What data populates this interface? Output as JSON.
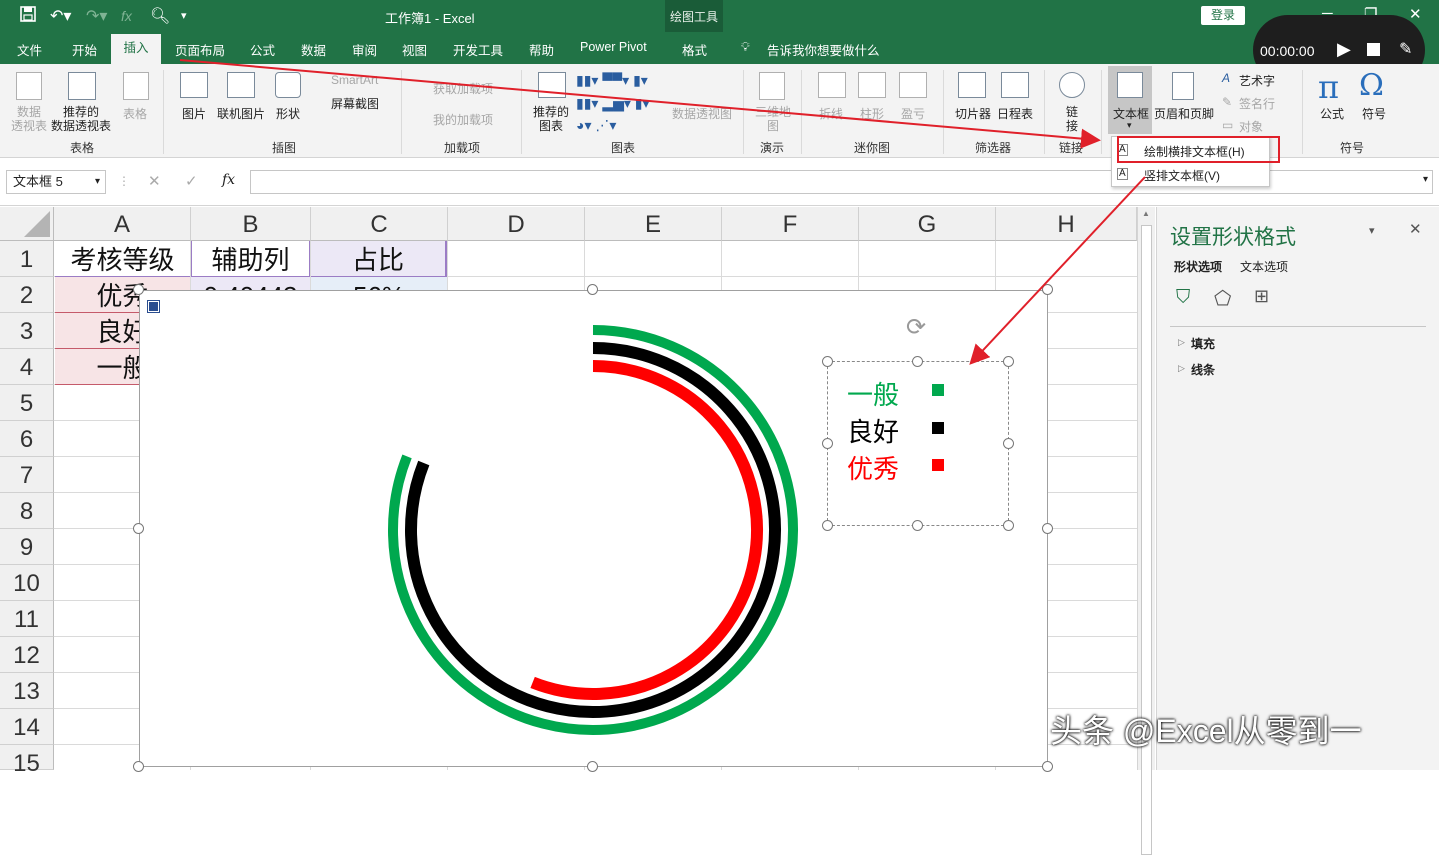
{
  "titlebar": {
    "doc_title": "工作簿1  -  Excel",
    "contextual_group": "绘图工具",
    "login": "登录"
  },
  "tabs": [
    "文件",
    "开始",
    "插入",
    "页面布局",
    "公式",
    "数据",
    "审阅",
    "视图",
    "开发工具",
    "帮助",
    "Power Pivot",
    "格式"
  ],
  "tell_me": "告诉我你想要做什么",
  "recorder": {
    "time": "00:00:00"
  },
  "ribbon": {
    "groups": {
      "tables": "表格",
      "illustrations": "插图",
      "addins": "加载项",
      "charts": "图表",
      "tours": "演示",
      "sparklines": "迷你图",
      "filters": "筛选器",
      "links": "链接",
      "text": "文本",
      "symbols": "符号"
    },
    "buttons": {
      "pivot_table": "数据\n透视表",
      "recommended_pivot": "推荐的\n数据透视表",
      "table": "表格",
      "pictures": "图片",
      "online_pictures": "联机图片",
      "shapes": "形状",
      "smartart": "SmartArt",
      "screenshot": "屏幕截图",
      "get_addins": "获取加载项",
      "my_addins": "我的加载项",
      "recommended_charts": "推荐的\n图表",
      "pivot_chart": "数据透视图",
      "map_3d": "三维地\n图",
      "line": "折线",
      "column": "柱形",
      "win_loss": "盈亏",
      "slicer": "切片器",
      "timeline": "日程表",
      "link": "链\n接",
      "textbox": "文本框",
      "header_footer": "页眉和页脚",
      "wordart": "艺术字",
      "signature": "签名行",
      "object": "对象",
      "equation": "公式",
      "symbol": "符号"
    }
  },
  "textbox_menu": {
    "horizontal": "绘制横排文本框(H)",
    "vertical": "竖排文本框(V)"
  },
  "formula_bar": {
    "name_box": "文本框 5",
    "fx": "fx",
    "formula": ""
  },
  "sheet": {
    "columns": [
      "A",
      "B",
      "C",
      "D",
      "E",
      "F",
      "G",
      "H"
    ],
    "rows": [
      "1",
      "2",
      "3",
      "4",
      "5",
      "6",
      "7",
      "8",
      "9",
      "10",
      "11",
      "12",
      "13",
      "14",
      "15"
    ],
    "cells": {
      "A1": "考核等级",
      "B1": "辅助列",
      "C1": "占比",
      "A2": "优秀",
      "B2": "0.40443",
      "C2": "56%",
      "A3": "良好",
      "A4": "一般"
    }
  },
  "chart_data": {
    "type": "doughnut-arcs",
    "series": [
      {
        "name": "一般",
        "color": "#00a84e",
        "fraction": 0.81
      },
      {
        "name": "良好",
        "color": "#000000",
        "fraction": 0.81
      },
      {
        "name": "优秀",
        "color": "#ff0000",
        "fraction": 0.56
      }
    ],
    "legend": [
      "一般",
      "良好",
      "优秀"
    ]
  },
  "pane": {
    "title": "设置形状格式",
    "tab_shape": "形状选项",
    "tab_text": "文本选项",
    "fill": "填充",
    "line": "线条"
  },
  "watermark": "头条 @Excel从零到一",
  "colors": {
    "excel_green": "#217346",
    "highlight_red": "#e0202a"
  }
}
